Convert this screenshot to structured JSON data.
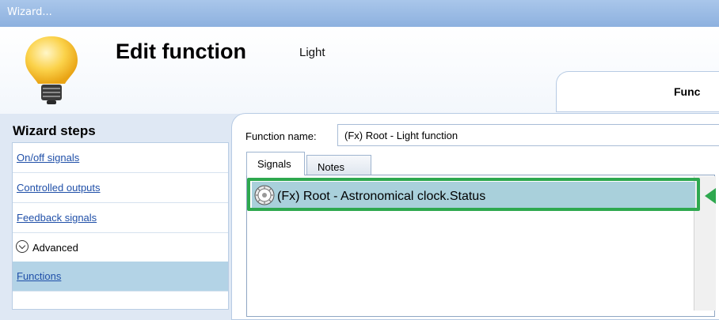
{
  "window": {
    "title": "Wizard..."
  },
  "header": {
    "title": "Edit function",
    "subtitle": "Light",
    "tab_label": "Func"
  },
  "sidebar": {
    "title": "Wizard steps",
    "items": [
      {
        "label": "On/off signals"
      },
      {
        "label": "Controlled outputs"
      },
      {
        "label": "Feedback signals"
      },
      {
        "label": "Advanced"
      },
      {
        "label": "Functions"
      }
    ]
  },
  "form": {
    "function_name_label": "Function name:",
    "function_name_value": "(Fx) Root - Light function"
  },
  "tabs": [
    {
      "label": "Signals"
    },
    {
      "label": "Notes"
    }
  ],
  "signals": [
    {
      "label": "(Fx) Root - Astronomical clock.Status",
      "icon": "astronomical-clock-icon"
    }
  ],
  "colors": {
    "highlight": "#2ea84f",
    "selection": "#a9d0db",
    "titlebar": "#8db1df"
  }
}
